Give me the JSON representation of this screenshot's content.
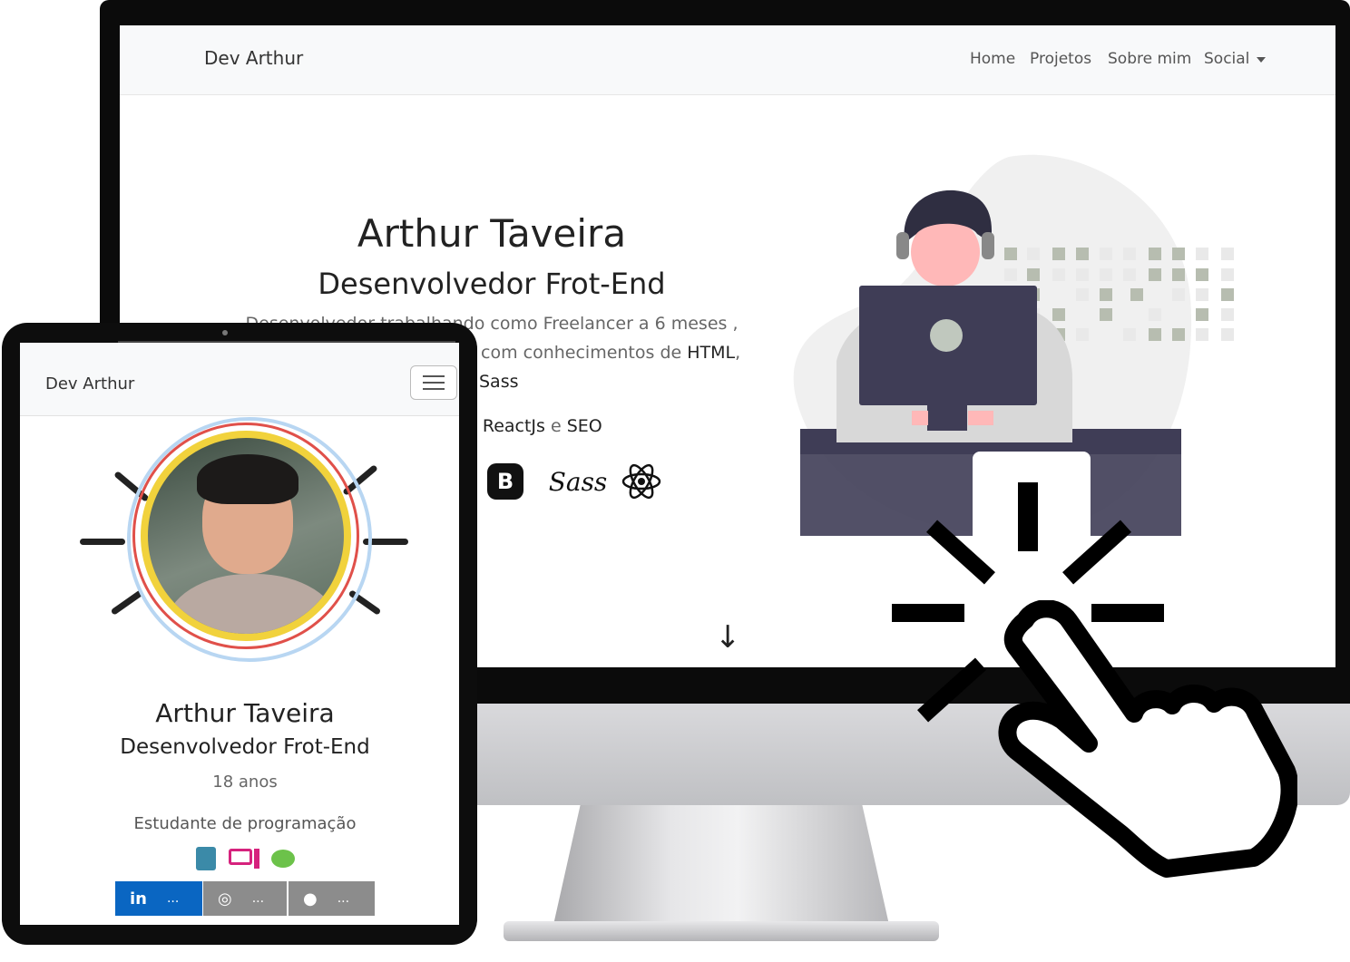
{
  "desktop": {
    "navbar": {
      "brand": "Dev Arthur",
      "links": [
        "Home",
        "Projetos",
        "Sobre mim",
        "Social"
      ]
    },
    "hero": {
      "name": "Arthur Taveira",
      "role": "Desenvolvedor Frot-End",
      "desc_line1": "Desenvolvedor trabalhando como Freelancer a 6 meses ,",
      "desc_line2_a": "com conhecimentos de ",
      "desc_line2_b": "HTML",
      "desc_line2_c": ",",
      "desc_line3": "Sass",
      "learning_a": "): ",
      "learning_b": "ReactJs",
      "learning_c": " e ",
      "learning_d": "SEO",
      "tech_icons": [
        "bootstrap-icon",
        "sass-icon",
        "react-icon"
      ],
      "bootstrap_letter": "B",
      "sass_label": "Sass",
      "scroll_arrow": "↓"
    }
  },
  "tablet": {
    "navbar": {
      "brand": "Dev Arthur"
    },
    "profile": {
      "name": "Arthur Taveira",
      "role": "Desenvolvedor Frot-End",
      "age": "18 anos",
      "occupation": "Estudante de programação",
      "hobby_icons": [
        "book-icon",
        "computer-icon",
        "food-icon"
      ]
    },
    "social": [
      {
        "icon": "linkedin-icon",
        "glyph": "in",
        "label": "...",
        "color": "#0a66c2"
      },
      {
        "icon": "instagram-icon",
        "glyph": "◎",
        "label": "...",
        "color": "#8c8c8c"
      },
      {
        "icon": "github-icon",
        "glyph": "●",
        "label": "...",
        "color": "#8c8c8c"
      }
    ]
  }
}
